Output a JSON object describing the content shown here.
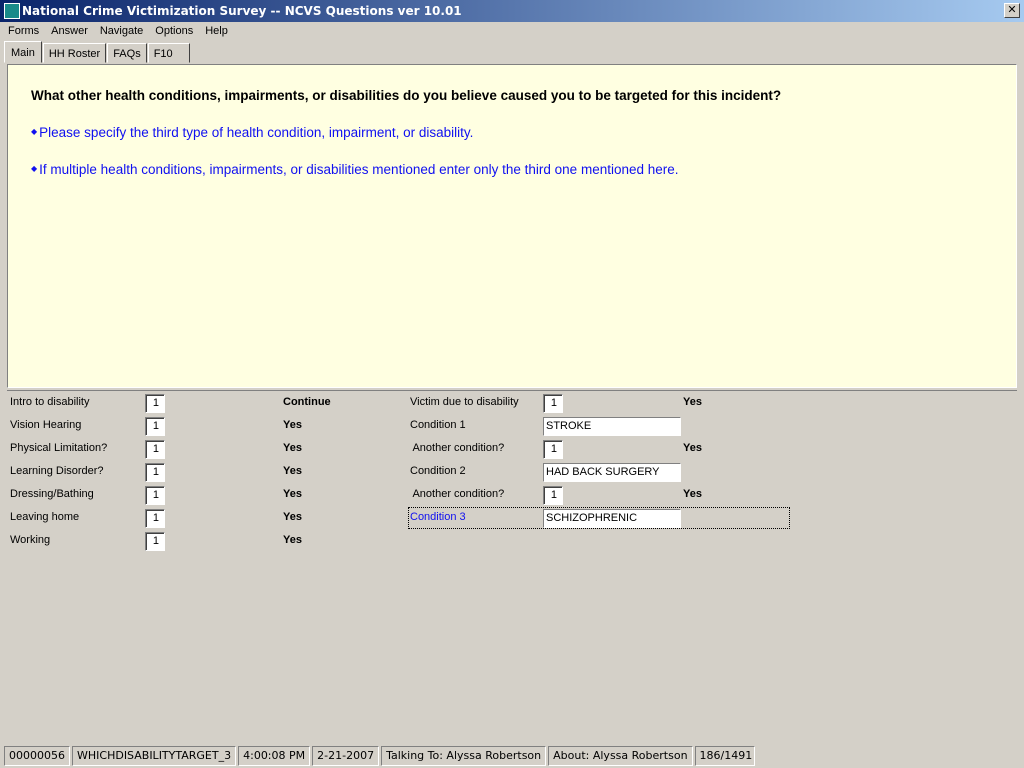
{
  "window": {
    "title": "National Crime Victimization Survey -- NCVS Questions ver 10.01",
    "close": "✕"
  },
  "menu": [
    "Forms",
    "Answer",
    "Navigate",
    "Options",
    "Help"
  ],
  "tabs": [
    "Main",
    "HH Roster",
    "FAQs",
    "F10"
  ],
  "question": {
    "text": "What other health conditions, impairments, or disabilities do you believe caused you to be targeted for this incident?",
    "instructions": [
      "Please specify the third type of health condition, impairment, or disability.",
      "If multiple health conditions, impairments, or disabilities mentioned enter only the third one mentioned here."
    ]
  },
  "left_fields": [
    {
      "label": "Intro to disability",
      "value": "1",
      "answer": "Continue"
    },
    {
      "label": "Vision Hearing",
      "value": "1",
      "answer": "Yes"
    },
    {
      "label": "Physical Limitation?",
      "value": "1",
      "answer": "Yes"
    },
    {
      "label": "Learning Disorder?",
      "value": "1",
      "answer": "Yes"
    },
    {
      "label": "Dressing/Bathing",
      "value": "1",
      "answer": "Yes"
    },
    {
      "label": "Leaving home",
      "value": "1",
      "answer": "Yes"
    },
    {
      "label": "Working",
      "value": "1",
      "answer": "Yes"
    }
  ],
  "right_fields": [
    {
      "label": "Victim due to disability",
      "value": "1",
      "answer": "Yes"
    },
    {
      "label": "Condition 1",
      "text": "STROKE"
    },
    {
      "label": " Another condition?",
      "value": "1",
      "answer": "Yes"
    },
    {
      "label": "Condition 2",
      "text": "HAD BACK SURGERY"
    },
    {
      "label": " Another condition?",
      "value": "1",
      "answer": "Yes"
    },
    {
      "label": "Condition 3",
      "text": "SCHIZOPHRENIC"
    }
  ],
  "status": [
    "00000056",
    "WHICHDISABILITYTARGET_3",
    "4:00:08 PM",
    "2-21-2007",
    "Talking To: Alyssa Robertson",
    "About:  Alyssa Robertson",
    "186/1491"
  ]
}
